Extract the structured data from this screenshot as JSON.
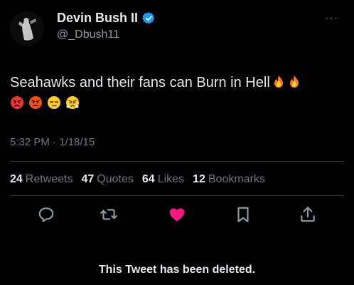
{
  "tweet": {
    "author": {
      "display_name": "Devin Bush II",
      "handle": "@_Dbush11",
      "verified": true,
      "avatar_icon": "avatar-silhouette-icon"
    },
    "more_icon": "more-horizontal-icon",
    "more_label": "···",
    "text": "Seahawks and their fans can Burn in Hell",
    "inline_emojis": [
      "fire-emoji",
      "fire-emoji"
    ],
    "emoji_row": [
      "enraged-face-emoji",
      "angry-face-emoji",
      "unamused-face-emoji",
      "face-with-steam-emoji"
    ],
    "timestamp": "5:32 PM · 1/18/15"
  },
  "stats": {
    "retweets": {
      "count": "24",
      "label": "Retweets"
    },
    "quotes": {
      "count": "47",
      "label": "Quotes"
    },
    "likes": {
      "count": "64",
      "label": "Likes"
    },
    "bookmarks": {
      "count": "12",
      "label": "Bookmarks"
    }
  },
  "actions": [
    {
      "name": "reply-icon"
    },
    {
      "name": "retweet-icon"
    },
    {
      "name": "like-icon",
      "color": "#f91880"
    },
    {
      "name": "bookmark-icon"
    },
    {
      "name": "share-icon"
    }
  ],
  "status_message": "This Tweet has been deleted.",
  "colors": {
    "background": "#000000",
    "text_primary": "#e7e9ea",
    "text_secondary": "#71767b",
    "verified": "#1d9bf0",
    "like": "#f91880",
    "divider": "#2f3336"
  }
}
